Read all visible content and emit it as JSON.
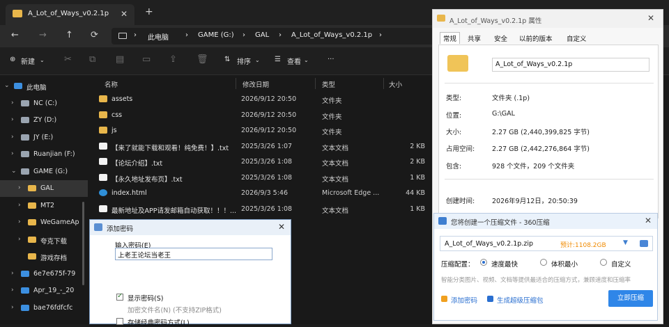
{
  "explorer": {
    "tab_title": "A_Lot_of_Ways_v0.2.1p",
    "tab_close": "✕",
    "new_tab": "+",
    "nav": {
      "back": "←",
      "forward": "→",
      "up": "↑",
      "refresh": "⟳"
    },
    "breadcrumb": [
      "此电脑",
      "GAME (G:)",
      "GAL",
      "A_Lot_of_Ways_v0.2.1p"
    ],
    "breadcrumb_sep": "›",
    "toolbar": {
      "new_label": "新建",
      "sort_label": "排序",
      "view_label": "查看",
      "more": "···"
    },
    "sidebar": [
      {
        "label": "此电脑",
        "icon": "pc-icon",
        "color": "#3c8fe0",
        "indent": 0,
        "chev": "⌄"
      },
      {
        "label": "NC (C:)",
        "icon": "drive-icon",
        "color": "#9aa4b0",
        "indent": 1,
        "chev": "›"
      },
      {
        "label": "ZY (D:)",
        "icon": "drive-icon",
        "color": "#9aa4b0",
        "indent": 1,
        "chev": "›"
      },
      {
        "label": "JY (E:)",
        "icon": "drive-icon",
        "color": "#9aa4b0",
        "indent": 1,
        "chev": "›"
      },
      {
        "label": "Ruanjian (F:)",
        "icon": "drive-icon",
        "color": "#9aa4b0",
        "indent": 1,
        "chev": "›"
      },
      {
        "label": "GAME (G:)",
        "icon": "drive-icon",
        "color": "#9aa4b0",
        "indent": 1,
        "chev": "⌄"
      },
      {
        "label": "GAL",
        "icon": "folder-icon",
        "color": "#e8b64b",
        "indent": 2,
        "chev": "›",
        "selected": true
      },
      {
        "label": "MT2",
        "icon": "folder-icon",
        "color": "#e8b64b",
        "indent": 2,
        "chev": "›"
      },
      {
        "label": "WeGameAp",
        "icon": "folder-icon",
        "color": "#e8b64b",
        "indent": 2,
        "chev": "›"
      },
      {
        "label": "夸克下载",
        "icon": "folder-icon",
        "color": "#e8b64b",
        "indent": 2,
        "chev": "›"
      },
      {
        "label": "游戏存档",
        "icon": "folder-icon",
        "color": "#e8b64b",
        "indent": 2,
        "chev": ""
      },
      {
        "label": "6e7e675f-79",
        "icon": "folder-icon",
        "color": "#3c8fe0",
        "indent": 1,
        "chev": "›"
      },
      {
        "label": "Apr_19_-_20",
        "icon": "folder-icon",
        "color": "#3c8fe0",
        "indent": 1,
        "chev": "›"
      },
      {
        "label": "bae76fdfcfc",
        "icon": "folder-icon",
        "color": "#3c8fe0",
        "indent": 1,
        "chev": "›"
      }
    ],
    "columns": {
      "name": "名称",
      "date": "修改日期",
      "type": "类型",
      "size": "大小"
    },
    "files": [
      {
        "name": "assets",
        "date": "2026/9/12 20:50",
        "type": "文件夹",
        "size": "",
        "kind": "folder"
      },
      {
        "name": "css",
        "date": "2026/9/12 20:50",
        "type": "文件夹",
        "size": "",
        "kind": "folder"
      },
      {
        "name": "js",
        "date": "2026/9/12 20:50",
        "type": "文件夹",
        "size": "",
        "kind": "folder"
      },
      {
        "name": "【来了就能下载和观看！纯免费！】.txt",
        "date": "2025/3/26 1:07",
        "type": "文本文档",
        "size": "2 KB",
        "kind": "doc"
      },
      {
        "name": "【论坛介绍】.txt",
        "date": "2025/3/26 1:08",
        "type": "文本文档",
        "size": "2 KB",
        "kind": "doc"
      },
      {
        "name": "【永久地址发布页】.txt",
        "date": "2025/3/26 1:08",
        "type": "文本文档",
        "size": "1 KB",
        "kind": "doc"
      },
      {
        "name": "index.html",
        "date": "2026/9/3 5:46",
        "type": "Microsoft Edge ...",
        "size": "44 KB",
        "kind": "edge"
      },
      {
        "name": "最新地址及APP请发邮箱自动获取！！！...",
        "date": "2025/3/26 1:08",
        "type": "文本文档",
        "size": "1 KB",
        "kind": "doc"
      }
    ]
  },
  "password_dialog": {
    "title": "添加密码",
    "close": "✕",
    "input_label": "输入密码(E)",
    "input_value": "上老王论坛当老王",
    "show_password": "显示密码(S)",
    "encrypt_names": "加密文件名(N) (不支持ZIP格式)",
    "save_password": "存储经典密码方式(L)"
  },
  "properties": {
    "title": "A_Lot_of_Ways_v0.2.1p 属性",
    "close": "✕",
    "tabs": [
      "常规",
      "共享",
      "安全",
      "以前的版本",
      "自定义"
    ],
    "name": "A_Lot_of_Ways_v0.2.1p",
    "rows": [
      {
        "k": "类型:",
        "v": "文件夹 (.1p)"
      },
      {
        "k": "位置:",
        "v": "G:\\GAL"
      },
      {
        "k": "大小:",
        "v": "2.27 GB (2,440,399,825 字节)"
      },
      {
        "k": "占用空间:",
        "v": "2.27 GB (2,442,276,864 字节)"
      },
      {
        "k": "包含:",
        "v": "928 个文件，209 个文件夹"
      },
      {
        "k": "创建时间:",
        "v": "2026年9月12日，20:50:39"
      }
    ]
  },
  "zip_dialog": {
    "title": "您将创建一个压缩文件 - 360压缩",
    "close": "✕",
    "filename": "A_Lot_of_Ways_v0.2.1p.zip",
    "size_est": "预计:1108.2GB",
    "dropdown": "▼",
    "config_label": "压缩配置：",
    "options": [
      {
        "label": "速度最快",
        "selected": true
      },
      {
        "label": "体积最小",
        "selected": false
      },
      {
        "label": "自定义",
        "selected": false
      }
    ],
    "hint": "智能分类图片、视频、文档等提供最适合的压缩方式，兼顾速度和压缩率",
    "add_password": "添加密码",
    "gen_volume": "生成超级压缩包",
    "start_button": "立即压缩"
  }
}
